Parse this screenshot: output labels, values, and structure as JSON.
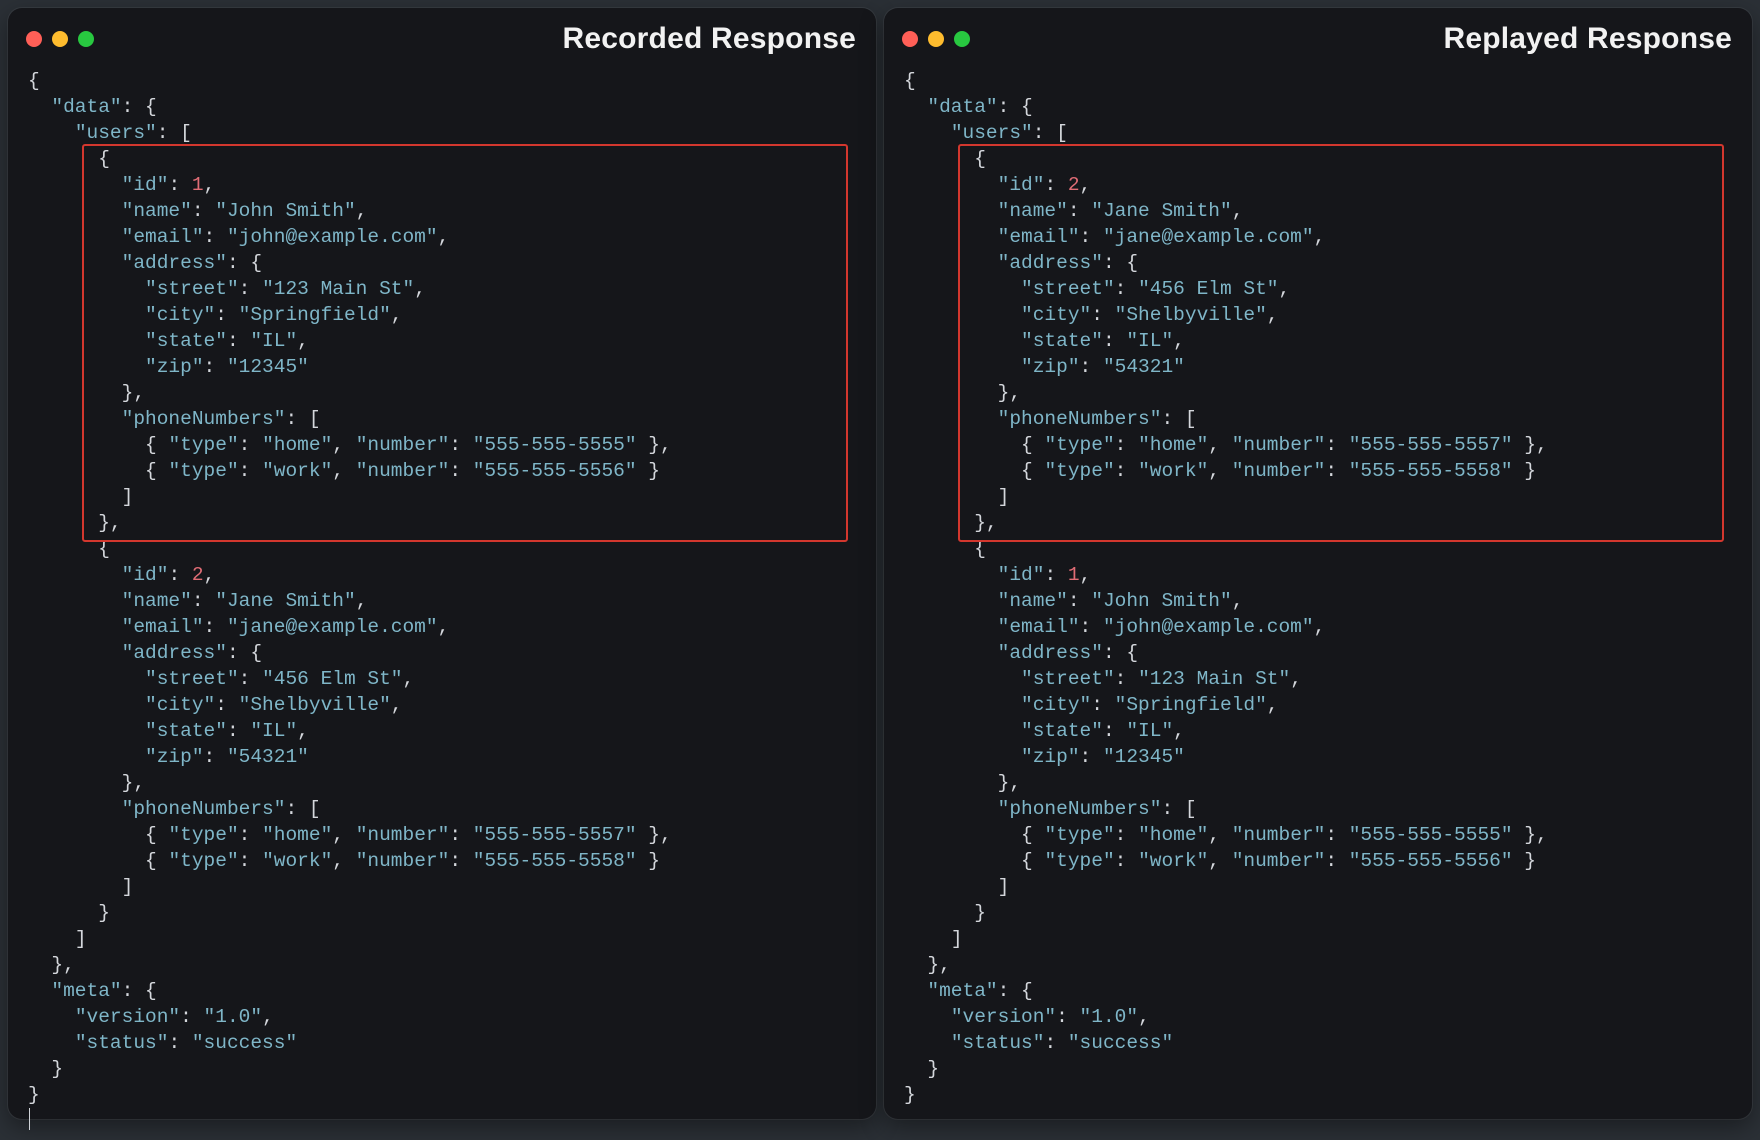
{
  "left": {
    "title": "Recorded Response",
    "highlight_user_index": 0,
    "payload": {
      "data": {
        "users": [
          {
            "id": 1,
            "name": "John Smith",
            "email": "john@example.com",
            "address": {
              "street": "123 Main St",
              "city": "Springfield",
              "state": "IL",
              "zip": "12345"
            },
            "phoneNumbers": [
              {
                "type": "home",
                "number": "555-555-5555"
              },
              {
                "type": "work",
                "number": "555-555-5556"
              }
            ]
          },
          {
            "id": 2,
            "name": "Jane Smith",
            "email": "jane@example.com",
            "address": {
              "street": "456 Elm St",
              "city": "Shelbyville",
              "state": "IL",
              "zip": "54321"
            },
            "phoneNumbers": [
              {
                "type": "home",
                "number": "555-555-5557"
              },
              {
                "type": "work",
                "number": "555-555-5558"
              }
            ]
          }
        ]
      },
      "meta": {
        "version": "1.0",
        "status": "success"
      }
    }
  },
  "right": {
    "title": "Replayed Response",
    "highlight_user_index": 0,
    "payload": {
      "data": {
        "users": [
          {
            "id": 2,
            "name": "Jane Smith",
            "email": "jane@example.com",
            "address": {
              "street": "456 Elm St",
              "city": "Shelbyville",
              "state": "IL",
              "zip": "54321"
            },
            "phoneNumbers": [
              {
                "type": "home",
                "number": "555-555-5557"
              },
              {
                "type": "work",
                "number": "555-555-5558"
              }
            ]
          },
          {
            "id": 1,
            "name": "John Smith",
            "email": "john@example.com",
            "address": {
              "street": "123 Main St",
              "city": "Springfield",
              "state": "IL",
              "zip": "12345"
            },
            "phoneNumbers": [
              {
                "type": "home",
                "number": "555-555-5555"
              },
              {
                "type": "work",
                "number": "555-555-5556"
              }
            ]
          }
        ]
      },
      "meta": {
        "version": "1.0",
        "status": "success"
      }
    }
  },
  "highlight_color": "#d3372e",
  "colors": {
    "background": "#15161a",
    "key": "#7fb6c8",
    "string": "#7fb6c8",
    "number": "#e06c75",
    "punct": "#d4d7dc"
  }
}
